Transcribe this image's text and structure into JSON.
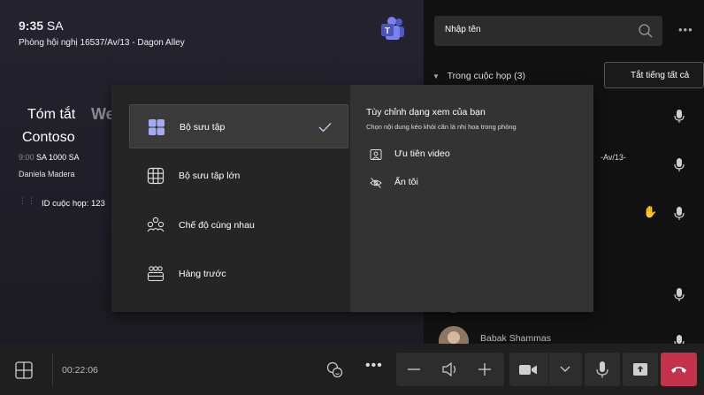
{
  "stage": {
    "time": "9:35",
    "ampm": "SA",
    "room": "Phòng hội nghị 16537/Av/13 - Dagon Alley",
    "summary_title": "Tóm tắt",
    "summary_watermark": "We",
    "summary_sub": "Contoso",
    "meet_time_dim": "9:00",
    "meet_time": "SA 1000 SA",
    "organizer": "Daniela Madera",
    "meeting_id": "ID cuộc họp: 123"
  },
  "roster": {
    "search_placeholder": "Nhập tên",
    "header": "Trong cuộc họp (3)",
    "mute_all": "Tắt tiếng tất cả",
    "partial_text": "-Av/13-",
    "participant_name": "Babak Shammas"
  },
  "layout_menu": {
    "options": [
      {
        "label": "Bộ sưu tập",
        "icon": "gallery-icon",
        "selected": true
      },
      {
        "label": "Bộ sưu tập lớn",
        "icon": "large-gallery-icon",
        "selected": false
      },
      {
        "label": "Chế độ cùng nhau",
        "icon": "together-mode-icon",
        "selected": false
      },
      {
        "label": "Hàng trước",
        "icon": "front-row-icon",
        "selected": false
      }
    ],
    "customize_title": "Tùy chỉnh dạng xem của bạn",
    "customize_desc": "Chọn nội dung kéo khỏi căn lá nhị hoa trong phòng",
    "custom_options": [
      {
        "label": "Ưu tiên video",
        "icon": "person-frame-icon"
      },
      {
        "label": "Ẩn tôi",
        "icon": "eye-off-icon"
      }
    ]
  },
  "bottom_bar": {
    "duration": "00:22:06"
  },
  "colors": {
    "accent": "#7b83eb",
    "end_call": "#c4314b",
    "stage_bg": "#24232f",
    "roster_bg": "#111111"
  }
}
